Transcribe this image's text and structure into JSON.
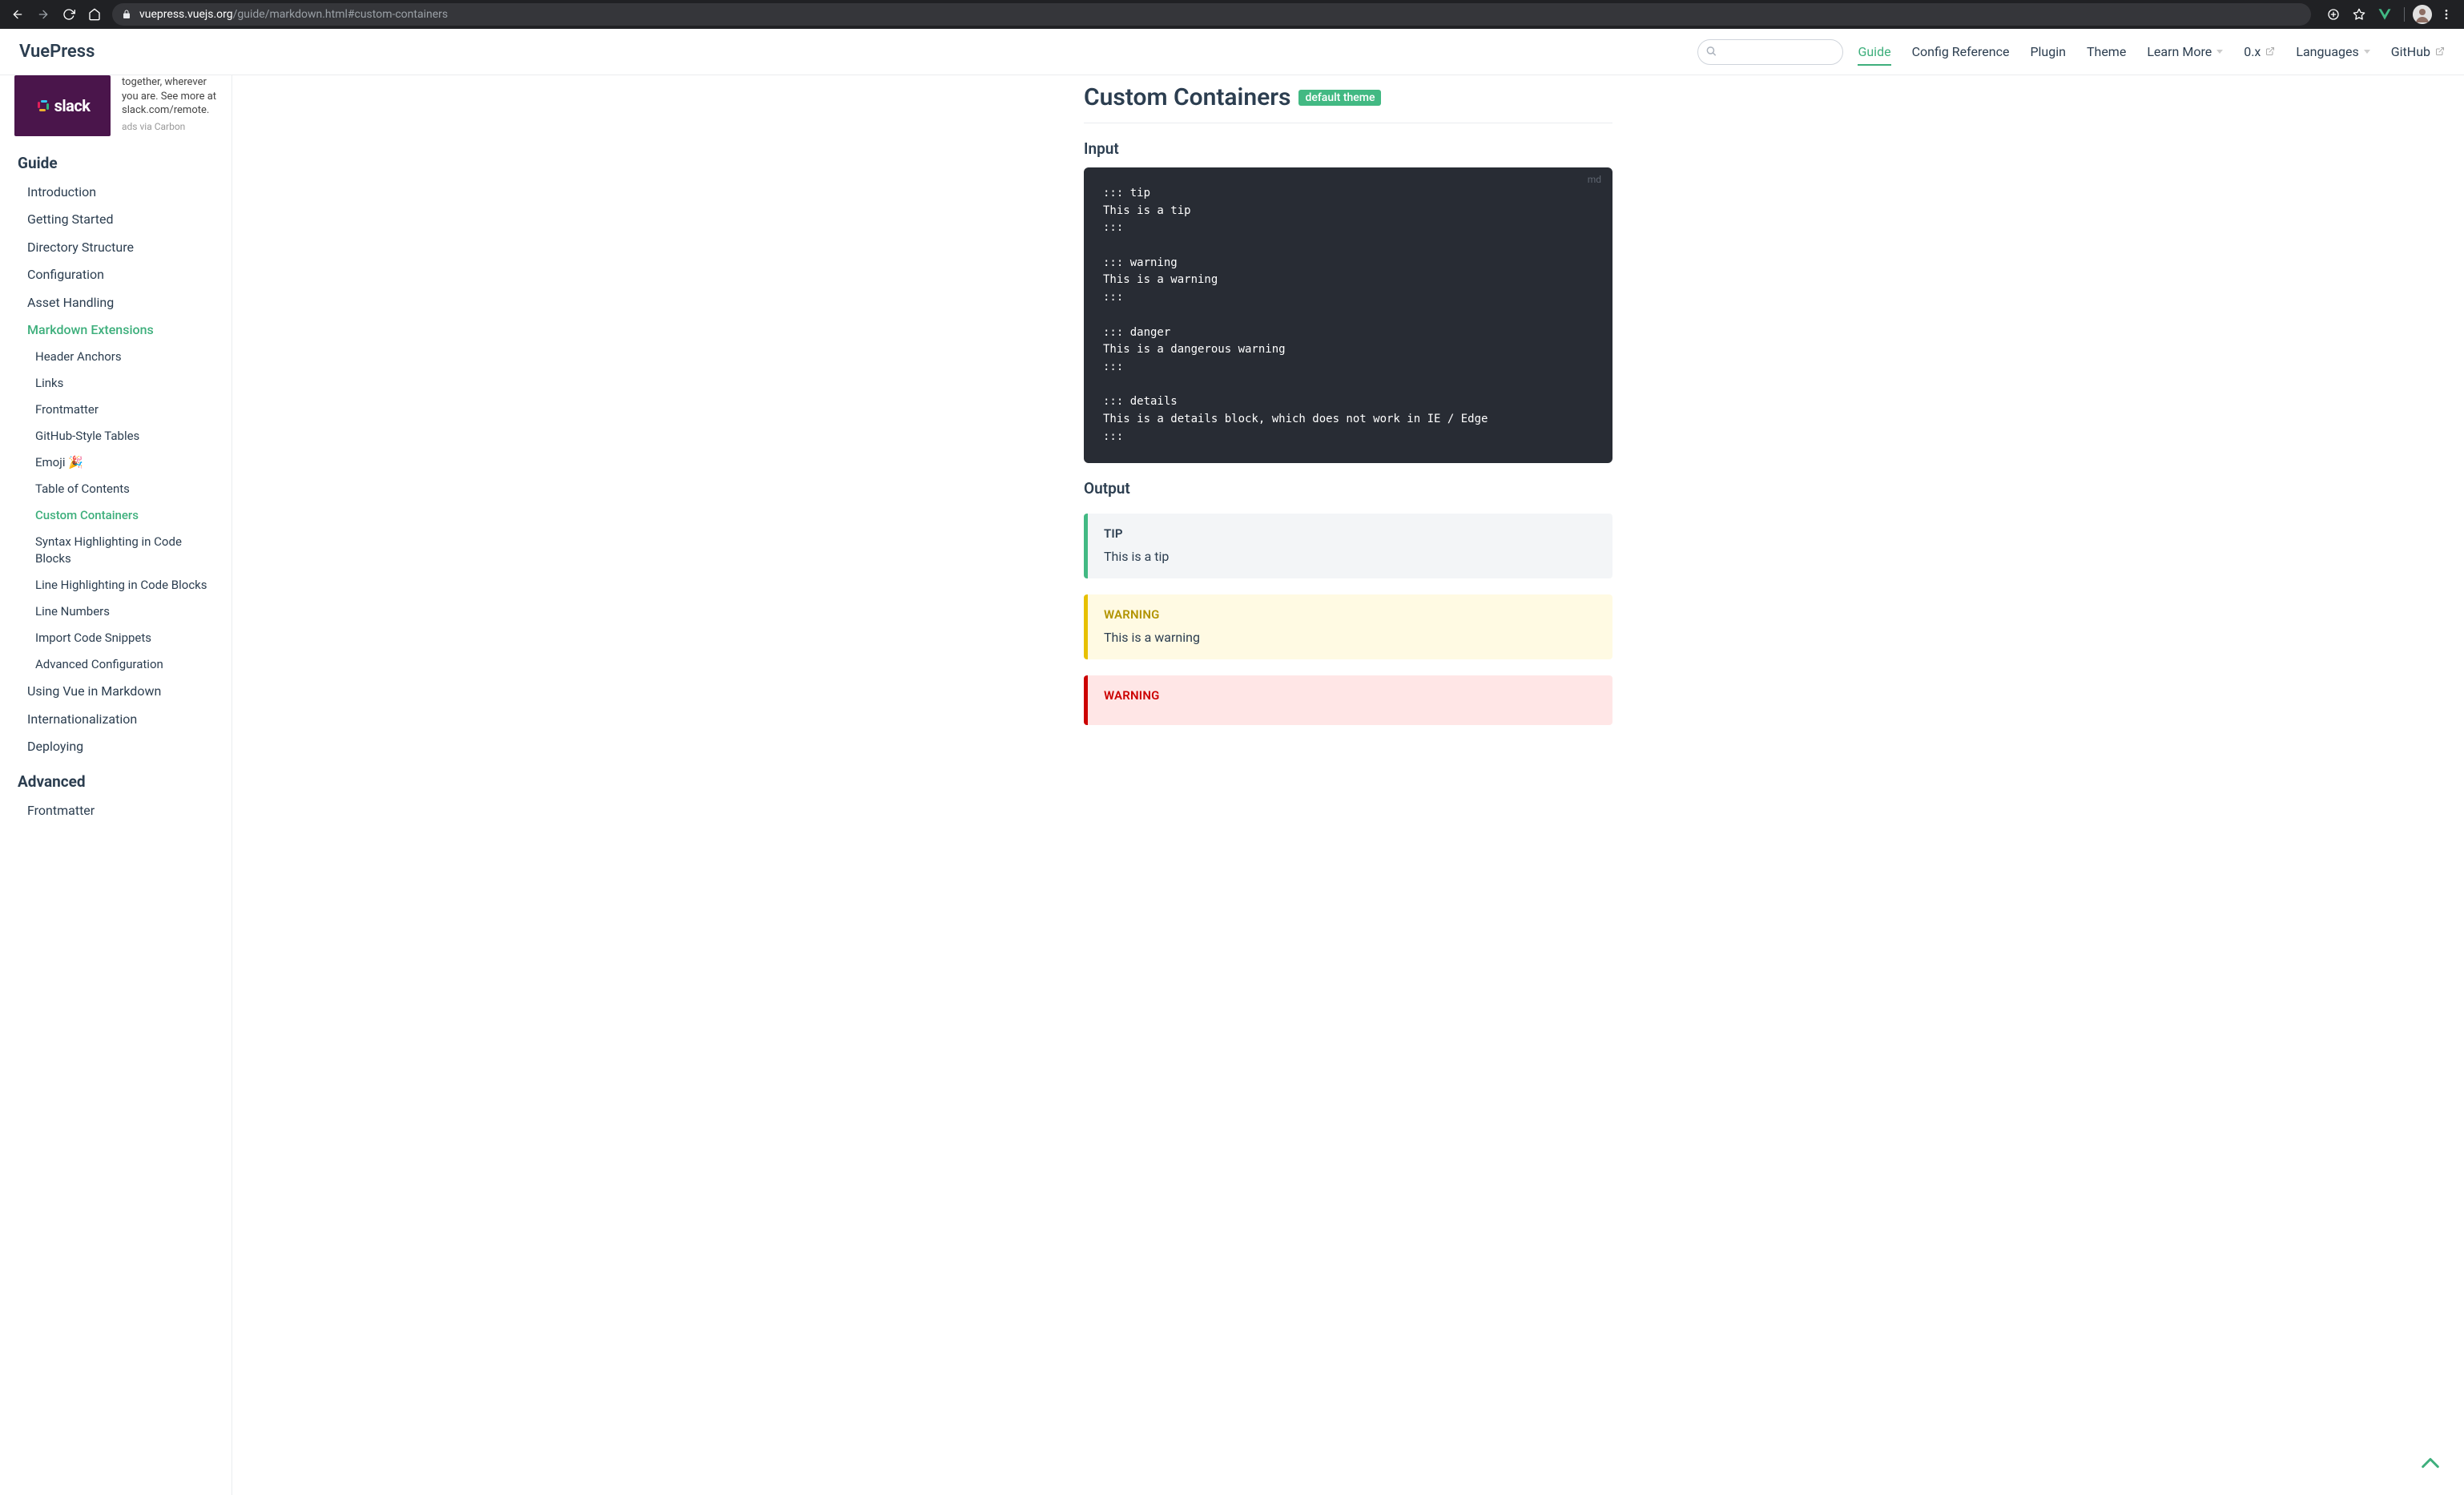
{
  "browser": {
    "url_host": "vuepress.vuejs.org",
    "url_path": "/guide/markdown.html#custom-containers"
  },
  "navbar": {
    "site_title": "VuePress",
    "search_placeholder": "",
    "links": [
      {
        "label": "Guide",
        "active": true,
        "dropdown": false,
        "external": false
      },
      {
        "label": "Config Reference",
        "active": false,
        "dropdown": false,
        "external": false
      },
      {
        "label": "Plugin",
        "active": false,
        "dropdown": false,
        "external": false
      },
      {
        "label": "Theme",
        "active": false,
        "dropdown": false,
        "external": false
      },
      {
        "label": "Learn More",
        "active": false,
        "dropdown": true,
        "external": false
      },
      {
        "label": "0.x",
        "active": false,
        "dropdown": false,
        "external": true
      },
      {
        "label": "Languages",
        "active": false,
        "dropdown": true,
        "external": false
      },
      {
        "label": "GitHub",
        "active": false,
        "dropdown": false,
        "external": true
      }
    ]
  },
  "sidebar": {
    "ad": {
      "brand": "slack",
      "copy": "together, wherever you are. See more at slack.com/remote.",
      "attribution": "ads via Carbon"
    },
    "groups": [
      {
        "title": "Guide",
        "items": [
          {
            "label": "Introduction"
          },
          {
            "label": "Getting Started"
          },
          {
            "label": "Directory Structure"
          },
          {
            "label": "Configuration"
          },
          {
            "label": "Asset Handling"
          },
          {
            "label": "Markdown Extensions",
            "active": true,
            "current": true,
            "children": [
              {
                "label": "Header Anchors"
              },
              {
                "label": "Links"
              },
              {
                "label": "Frontmatter"
              },
              {
                "label": "GitHub-Style Tables"
              },
              {
                "label": "Emoji 🎉"
              },
              {
                "label": "Table of Contents"
              },
              {
                "label": "Custom Containers",
                "active": true
              },
              {
                "label": "Syntax Highlighting in Code Blocks"
              },
              {
                "label": "Line Highlighting in Code Blocks"
              },
              {
                "label": "Line Numbers"
              },
              {
                "label": "Import Code Snippets"
              },
              {
                "label": "Advanced Configuration"
              }
            ]
          },
          {
            "label": "Using Vue in Markdown"
          },
          {
            "label": "Internationalization"
          },
          {
            "label": "Deploying"
          }
        ]
      },
      {
        "title": "Advanced",
        "items": [
          {
            "label": "Frontmatter"
          }
        ]
      }
    ]
  },
  "content": {
    "heading": "Custom Containers",
    "heading_badge": "default theme",
    "input_title": "Input",
    "code_language": "md",
    "code": "::: tip\nThis is a tip\n:::\n\n::: warning\nThis is a warning\n:::\n\n::: danger\nThis is a dangerous warning\n:::\n\n::: details\nThis is a details block, which does not work in IE / Edge\n:::",
    "output_title": "Output",
    "blocks": {
      "tip": {
        "title": "TIP",
        "body": "This is a tip"
      },
      "warning": {
        "title": "WARNING",
        "body": "This is a warning"
      },
      "danger": {
        "title": "WARNING",
        "body": ""
      }
    }
  }
}
